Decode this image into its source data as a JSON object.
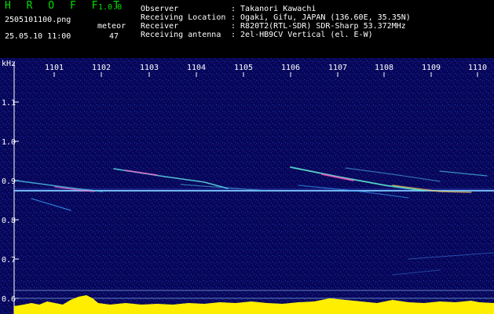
{
  "header": {
    "app_title": "H R O F F T",
    "version": "1.0.0",
    "filename": "2505101100.png",
    "datetime": "25.05.10 11:00",
    "meteor_label": "meteor",
    "meteor_count": "47",
    "fields": [
      {
        "label": "Observer",
        "value": ": Takanori Kawachi"
      },
      {
        "label": "Receiving Location",
        "value": ": Ogaki, Gifu, JAPAN (136.60E, 35.35N)"
      },
      {
        "label": "Receiver",
        "value": ": R820T2(RTL-SDR) SDR-Sharp 53.372MHz"
      },
      {
        "label": "Receiving antenna",
        "value": ": 2el-HB9CV Vertical (el. E-W)"
      }
    ]
  },
  "axes": {
    "y_unit": "kHz",
    "y_ticks": [
      "1.1",
      "1.0",
      "0.9",
      "0.8",
      "0.7",
      "0.6"
    ],
    "x_ticks": [
      "1101",
      "1102",
      "1103",
      "1104",
      "1105",
      "1106",
      "1107",
      "1108",
      "1109",
      "1110"
    ]
  },
  "colors": {
    "background": "#0a0a5a",
    "carrier": "#9ad8ff",
    "activity": "#ffee00",
    "baseline": "#22ccff"
  }
}
